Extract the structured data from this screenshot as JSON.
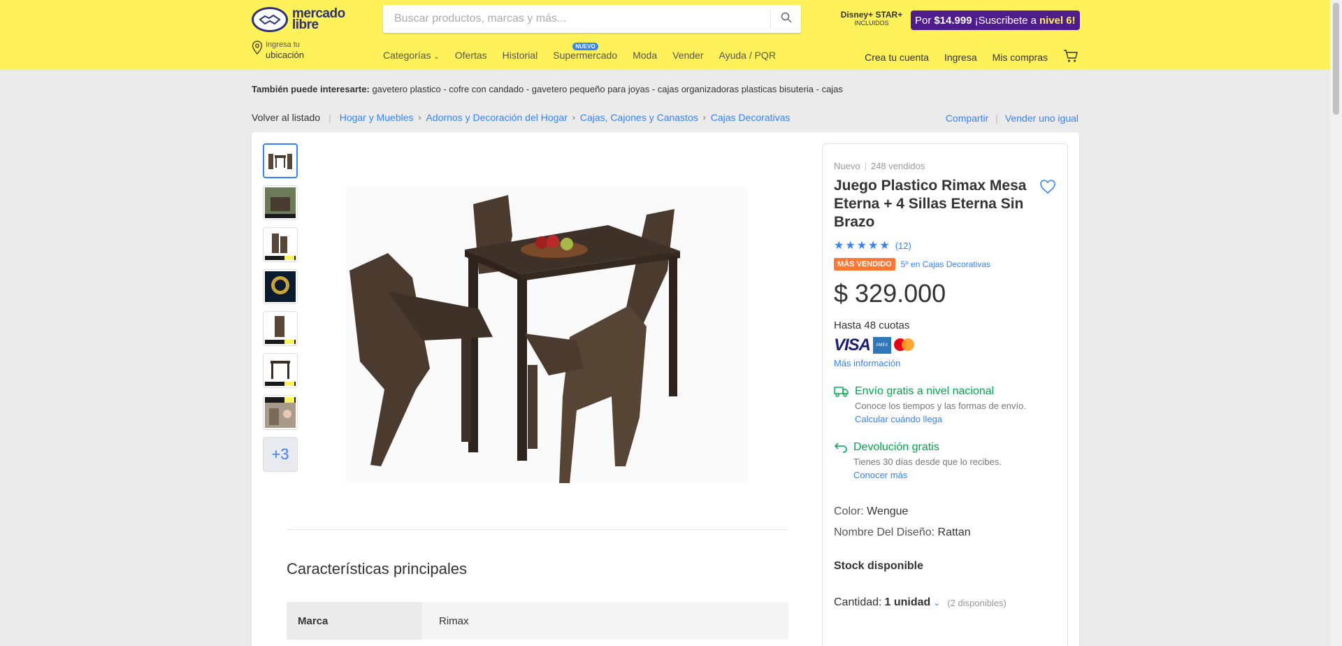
{
  "header": {
    "logo_line1": "mercado",
    "logo_line2": "libre",
    "search_placeholder": "Buscar productos, marcas y más...",
    "disney_label": "Disney+ STAR+",
    "disney_sub": "INCLUIDOS",
    "promo_prefix": "Por",
    "promo_price": "$14.999",
    "promo_text": "¡Suscribete a",
    "promo_level": "nivel 6!",
    "location_small": "Ingresa tu",
    "location_main": "ubicación",
    "nav": [
      "Categorías",
      "Ofertas",
      "Historial",
      "Supermercado",
      "Moda",
      "Vender",
      "Ayuda / PQR"
    ],
    "nav_badge": "NUEVO",
    "account": [
      "Crea tu cuenta",
      "Ingresa",
      "Mis compras"
    ]
  },
  "suggest": {
    "label": "También puede interesarte:",
    "items": "gavetero plastico - cofre con candado - gavetero pequeño para joyas - cajas organizadoras plasticas bisuteria - cajas"
  },
  "breadcrumb": {
    "back": "Volver al listado",
    "items": [
      "Hogar y Muebles",
      "Adornos y Decoración del Hogar",
      "Cajas, Cajones y Canastos",
      "Cajas Decorativas"
    ],
    "share": "Compartir",
    "sell": "Vender uno igual"
  },
  "gallery": {
    "more": "+3"
  },
  "features": {
    "title": "Características principales",
    "rows": [
      {
        "key": "Marca",
        "value": "Rimax"
      }
    ]
  },
  "product": {
    "condition": "Nuevo",
    "sold": "248 vendidos",
    "title": "Juego Plastico Rimax Mesa Eterna + 4 Sillas Eterna Sin Brazo",
    "rating": 5,
    "reviews": "(12)",
    "best_seller": "MÁS VENDIDO",
    "rank": "5º en Cajas Decorativas",
    "price": "$ 329.000",
    "installments": "Hasta 48 cuotas",
    "more_info": "Más información",
    "shipping_title": "Envío gratis a nivel nacional",
    "shipping_sub": "Conoce los tiempos y las formas de envío.",
    "shipping_link": "Calcular cuándo llega",
    "return_title": "Devolución gratis",
    "return_sub": "Tienes 30 días desde que lo recibes.",
    "return_link": "Conocer más",
    "color_label": "Color:",
    "color_value": "Wengue",
    "design_label": "Nombre Del Diseño:",
    "design_value": "Rattan",
    "stock": "Stock disponible",
    "qty_label": "Cantidad:",
    "qty_value": "1 unidad",
    "qty_avail": "(2 disponibles)"
  },
  "colors": {
    "brand_yellow": "#fff159",
    "link_blue": "#3483fa",
    "success_green": "#00a650",
    "best_orange": "#ff7733"
  }
}
